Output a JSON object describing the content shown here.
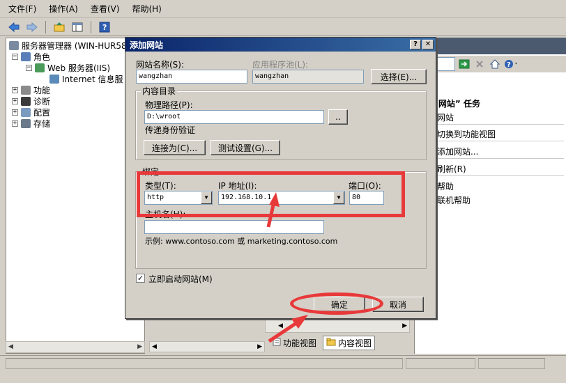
{
  "menubar": {
    "items": [
      "文件(F)",
      "操作(A)",
      "查看(V)",
      "帮助(H)"
    ]
  },
  "toolbar": {
    "icons": [
      "back-arrow-icon",
      "forward-arrow-icon",
      "up-folder-icon",
      "show-hide-console-icon",
      "help-icon"
    ]
  },
  "tree": {
    "root": "服务器管理器 (WIN-HUR580",
    "roles": "角色",
    "web_server": "Web 服务器(IIS)",
    "iis_manager": "Internet 信息服",
    "features": "功能",
    "diagnostics": "诊断",
    "configuration": "配置",
    "storage": "存储"
  },
  "actions": {
    "title": "“网站” 任务",
    "items": [
      "网站",
      "切换到功能视图",
      "添加网站...",
      "刷新(R)",
      "帮助",
      "联机帮助"
    ]
  },
  "view_tabs": {
    "features_view": "功能视图",
    "content_view": "内容视图"
  },
  "dialog": {
    "title": "添加网站",
    "help_btn": "?",
    "close_btn": "✕",
    "site_name_label": "网站名称(S):",
    "site_name_value": "wangzhan",
    "app_pool_label": "应用程序池(L):",
    "app_pool_value": "wangzhan",
    "select_btn": "选择(E)...",
    "content_dir_label": "内容目录",
    "physical_path_label": "物理路径(P):",
    "physical_path_value": "D:\\wroot",
    "browse_btn": "..",
    "pass_auth_label": "传递身份验证",
    "connect_as_btn": "连接为(C)...",
    "test_settings_btn": "测试设置(G)...",
    "binding_label": "绑定",
    "type_label": "类型(T):",
    "type_value": "http",
    "ip_label": "IP 地址(I):",
    "ip_value": "192.168.10.1",
    "port_label": "端口(O):",
    "port_value": "80",
    "hostname_label": "主机名(H):",
    "hostname_value": "",
    "example_text": "示例: www.contoso.com 或 marketing.contoso.com",
    "start_immediately_label": "立即启动网站(M)",
    "start_immediately_checked": "✓",
    "ok_btn": "确定",
    "cancel_btn": "取消"
  },
  "annotation_colors": {
    "red": "#e8393a"
  }
}
